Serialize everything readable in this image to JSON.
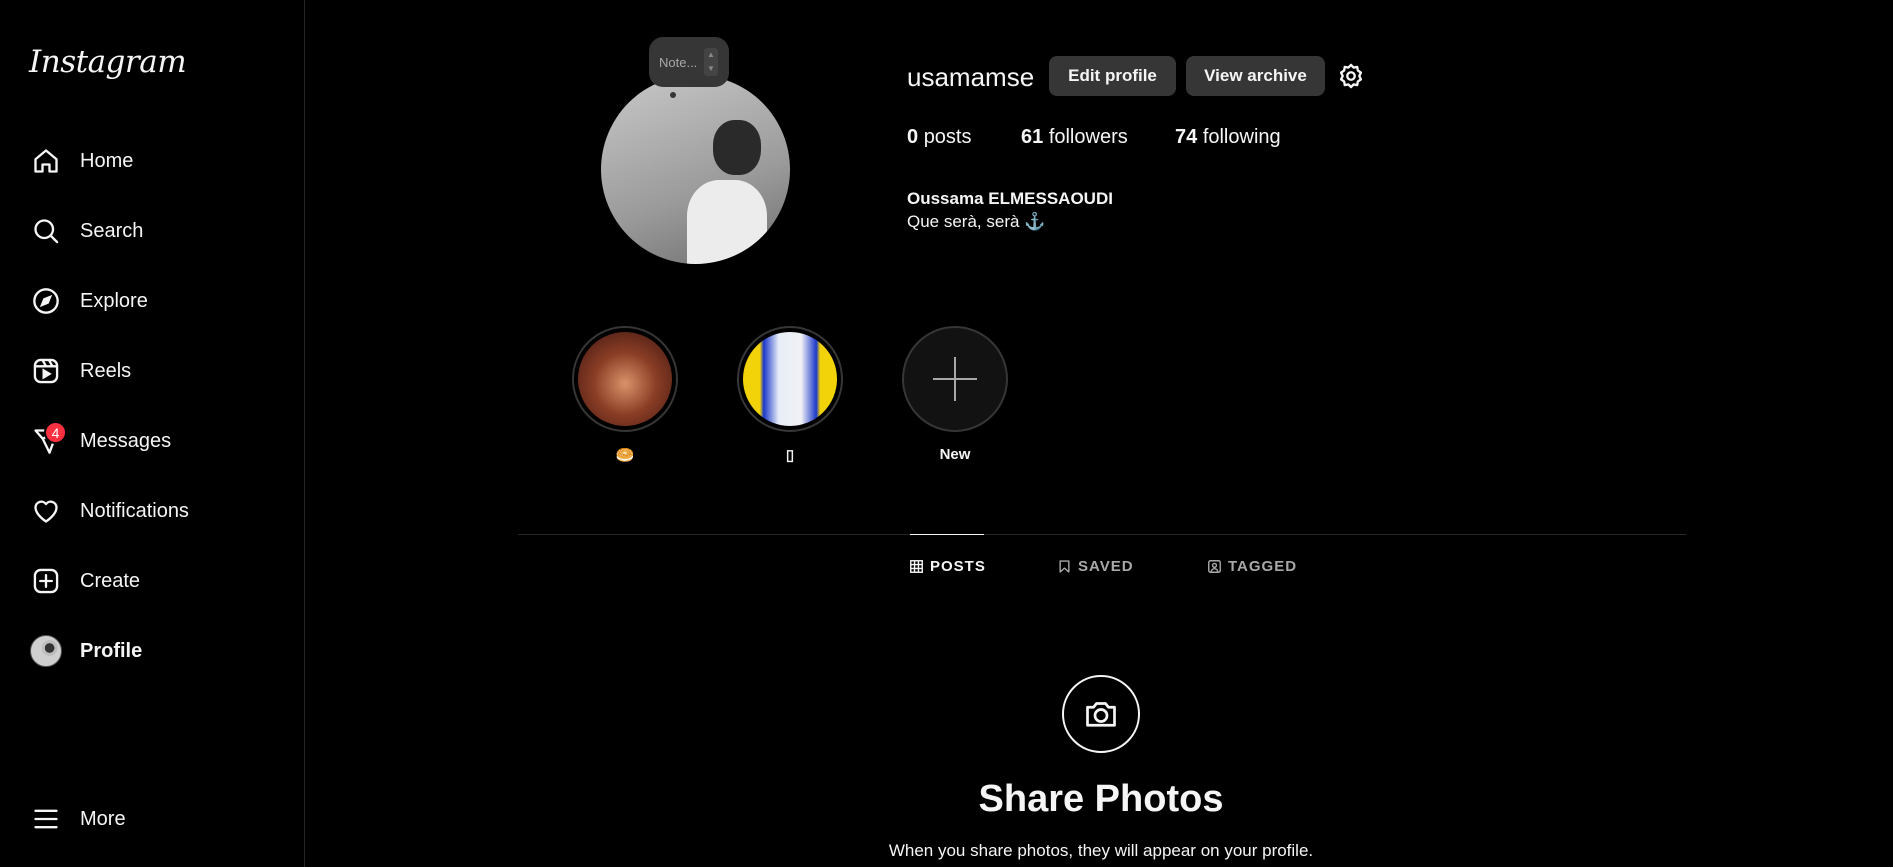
{
  "sidebar": {
    "logo": "Instagram",
    "items": [
      {
        "label": "Home",
        "icon": "home-icon"
      },
      {
        "label": "Search",
        "icon": "search-icon"
      },
      {
        "label": "Explore",
        "icon": "compass-icon"
      },
      {
        "label": "Reels",
        "icon": "reels-icon"
      },
      {
        "label": "Messages",
        "icon": "messenger-icon",
        "badge": "4"
      },
      {
        "label": "Notifications",
        "icon": "heart-icon"
      },
      {
        "label": "Create",
        "icon": "plus-square-icon"
      },
      {
        "label": "Profile",
        "icon": "avatar"
      }
    ],
    "more": "More"
  },
  "profile": {
    "note_placeholder": "Note...",
    "username": "usamamse",
    "edit_button": "Edit profile",
    "archive_button": "View archive",
    "stats": {
      "posts_count": "0",
      "posts_label": "posts",
      "followers_count": "61",
      "followers_label": "followers",
      "following_count": "74",
      "following_label": "following"
    },
    "full_name": "Oussama ELMESSAOUDI",
    "bio": "Que serà, serà ⚓"
  },
  "highlights": [
    {
      "label": "🥯"
    },
    {
      "label": "▯"
    },
    {
      "label": "New"
    }
  ],
  "tabs": [
    {
      "label": "POSTS",
      "icon": "grid-icon",
      "active": true
    },
    {
      "label": "SAVED",
      "icon": "bookmark-icon",
      "active": false
    },
    {
      "label": "TAGGED",
      "icon": "tagged-icon",
      "active": false
    }
  ],
  "empty_state": {
    "icon": "camera-icon",
    "title": "Share Photos",
    "subtitle": "When you share photos, they will appear on your profile."
  },
  "colors": {
    "background": "#000000",
    "button": "#363636",
    "badge": "#ff3040",
    "text": "#f5f5f5",
    "muted": "#a8a8a8"
  }
}
